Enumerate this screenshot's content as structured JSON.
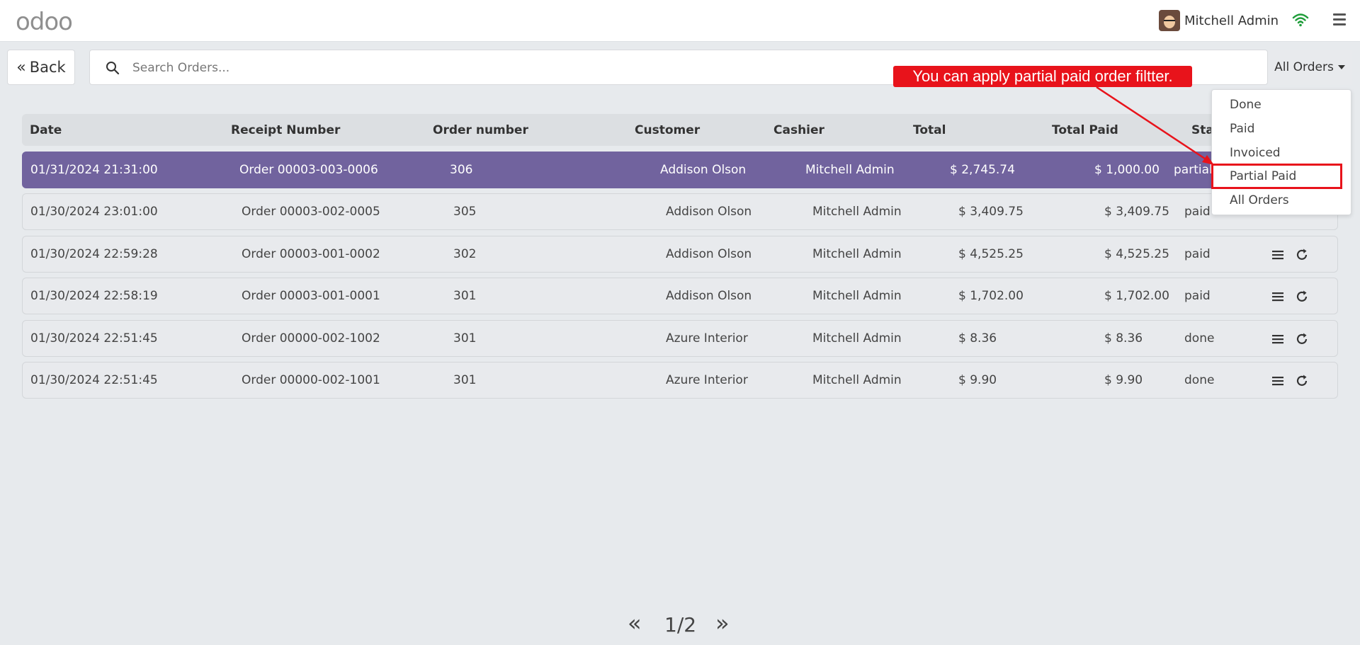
{
  "app": {
    "logo": "odoo"
  },
  "user": {
    "name": "Mitchell Admin"
  },
  "toolbar": {
    "back_label": "Back",
    "search_placeholder": "Search Orders...",
    "filter_label": "All Orders"
  },
  "table": {
    "headers": [
      "Date",
      "Receipt Number",
      "Order number",
      "Customer",
      "Cashier",
      "Total",
      "Total Paid",
      "Sta"
    ],
    "rows": [
      {
        "date": "01/31/2024 21:31:00",
        "receipt": "Order 00003-003-0006",
        "order": "306",
        "customer": "Addison Olson",
        "cashier": "Mitchell Admin",
        "total": "$ 2,745.74",
        "paid": "$ 1,000.00",
        "status": "partial_"
      },
      {
        "date": "01/30/2024 23:01:00",
        "receipt": "Order 00003-002-0005",
        "order": "305",
        "customer": "Addison Olson",
        "cashier": "Mitchell Admin",
        "total": "$ 3,409.75",
        "paid": "$ 3,409.75",
        "status": "paid"
      },
      {
        "date": "01/30/2024 22:59:28",
        "receipt": "Order 00003-001-0002",
        "order": "302",
        "customer": "Addison Olson",
        "cashier": "Mitchell Admin",
        "total": "$ 4,525.25",
        "paid": "$ 4,525.25",
        "status": "paid"
      },
      {
        "date": "01/30/2024 22:58:19",
        "receipt": "Order 00003-001-0001",
        "order": "301",
        "customer": "Addison Olson",
        "cashier": "Mitchell Admin",
        "total": "$ 1,702.00",
        "paid": "$ 1,702.00",
        "status": "paid"
      },
      {
        "date": "01/30/2024 22:51:45",
        "receipt": "Order 00000-002-1002",
        "order": "301",
        "customer": "Azure Interior",
        "cashier": "Mitchell Admin",
        "total": "$ 8.36",
        "paid": "$ 8.36",
        "status": "done"
      },
      {
        "date": "01/30/2024 22:51:45",
        "receipt": "Order 00000-002-1001",
        "order": "301",
        "customer": "Azure Interior",
        "cashier": "Mitchell Admin",
        "total": "$ 9.90",
        "paid": "$ 9.90",
        "status": "done"
      }
    ]
  },
  "filter_menu": {
    "items": [
      "Done",
      "Paid",
      "Invoiced",
      "Partial Paid",
      "All Orders"
    ]
  },
  "annotation": {
    "text": "You can apply partial paid order filtter."
  },
  "pager": {
    "text": "1/2"
  },
  "icons": {
    "logo": "odoo-logo",
    "wifi": "wifi-icon",
    "menu": "hamburger-icon",
    "back": "double-chevron-left-icon",
    "search": "search-icon",
    "row_menu": "list-icon",
    "row_refresh": "refresh-icon",
    "prev": "double-chevron-left-icon",
    "next": "double-chevron-right-icon"
  },
  "colors": {
    "brand": "#714b67",
    "selected_row": "#71639e",
    "annotation": "#e8131b",
    "wifi": "#1f9d3a"
  }
}
